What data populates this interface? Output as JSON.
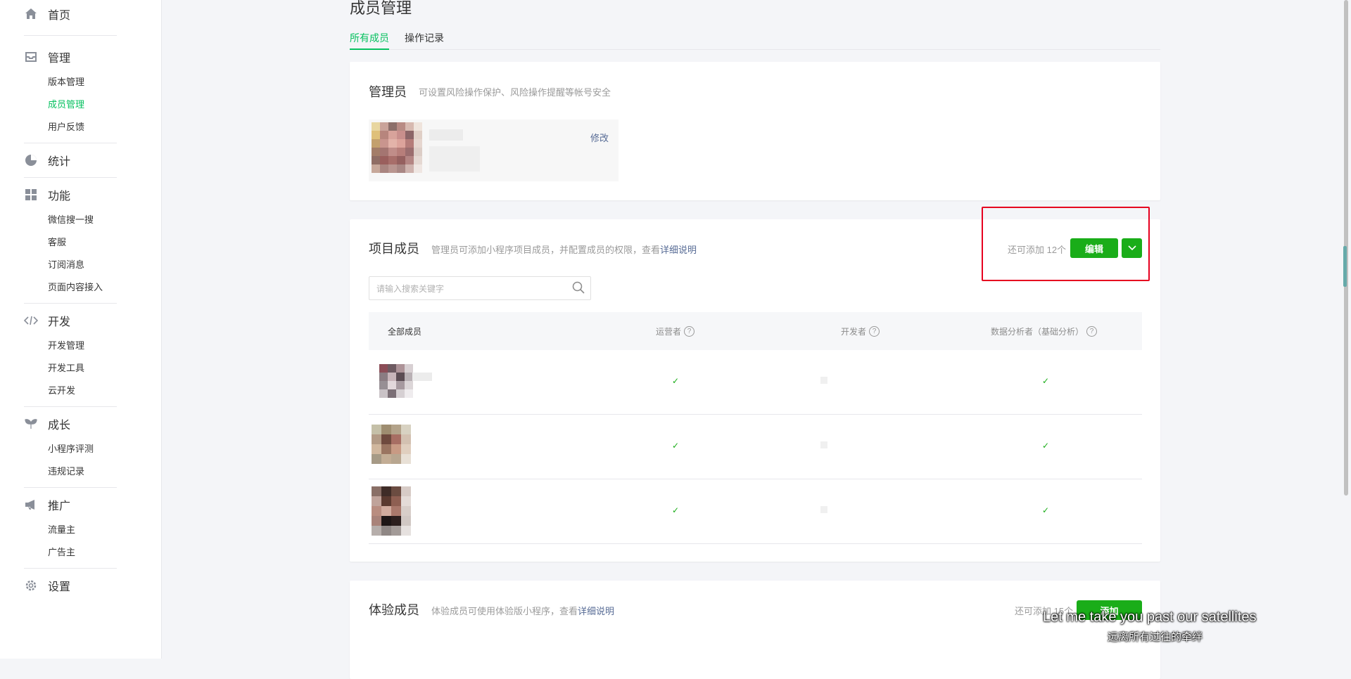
{
  "sidebar": {
    "groups": [
      {
        "label": "首页",
        "icon": "home-icon",
        "items": []
      },
      {
        "label": "管理",
        "icon": "inbox-icon",
        "items": [
          {
            "label": "版本管理",
            "active": false
          },
          {
            "label": "成员管理",
            "active": true
          },
          {
            "label": "用户反馈",
            "active": false
          }
        ]
      },
      {
        "label": "统计",
        "icon": "pie-chart-icon",
        "items": []
      },
      {
        "label": "功能",
        "icon": "grid-icon",
        "items": [
          {
            "label": "微信搜一搜"
          },
          {
            "label": "客服"
          },
          {
            "label": "订阅消息"
          },
          {
            "label": "页面内容接入"
          }
        ]
      },
      {
        "label": "开发",
        "icon": "code-icon",
        "items": [
          {
            "label": "开发管理"
          },
          {
            "label": "开发工具"
          },
          {
            "label": "云开发"
          }
        ]
      },
      {
        "label": "成长",
        "icon": "sprout-icon",
        "items": [
          {
            "label": "小程序评测"
          },
          {
            "label": "违规记录"
          }
        ]
      },
      {
        "label": "推广",
        "icon": "megaphone-icon",
        "items": [
          {
            "label": "流量主"
          },
          {
            "label": "广告主"
          }
        ]
      },
      {
        "label": "设置",
        "icon": "gear-icon",
        "items": []
      }
    ]
  },
  "page": {
    "title": "成员管理",
    "tabs": [
      {
        "label": "所有成员",
        "active": true
      },
      {
        "label": "操作记录",
        "active": false
      }
    ]
  },
  "admin": {
    "title": "管理员",
    "desc": "可设置风险操作保护、风险操作提醒等帐号安全",
    "edit_label": "修改"
  },
  "project": {
    "title": "项目成员",
    "desc_prefix": "管理员可添加小程序项目成员，并配置成员的权限，查看",
    "desc_link": "详细说明",
    "quota": "还可添加 12个",
    "edit_label": "编辑",
    "search_placeholder": "请输入搜索关键字",
    "columns": [
      "全部成员",
      "运营者",
      "开发者",
      "数据分析者（基础分析）"
    ],
    "rows": [
      {
        "operator": "✓",
        "developer": "",
        "analyst": "✓"
      },
      {
        "operator": "✓",
        "developer": "",
        "analyst": "✓"
      },
      {
        "operator": "✓",
        "developer": "",
        "analyst": "✓"
      }
    ]
  },
  "trial": {
    "title": "体验成员",
    "desc_prefix": "体验成员可使用体验版小程序，查看",
    "desc_link": "详细说明",
    "quota": "还可添加 15个",
    "add_label": "添加"
  },
  "subtitles": {
    "en": "Let me take you past our satellites",
    "cn": "远离所有过往的牵绊"
  },
  "colors": {
    "accent": "#07c160",
    "button": "#1aad19",
    "link": "#576b95",
    "highlight": "#e6001f"
  }
}
